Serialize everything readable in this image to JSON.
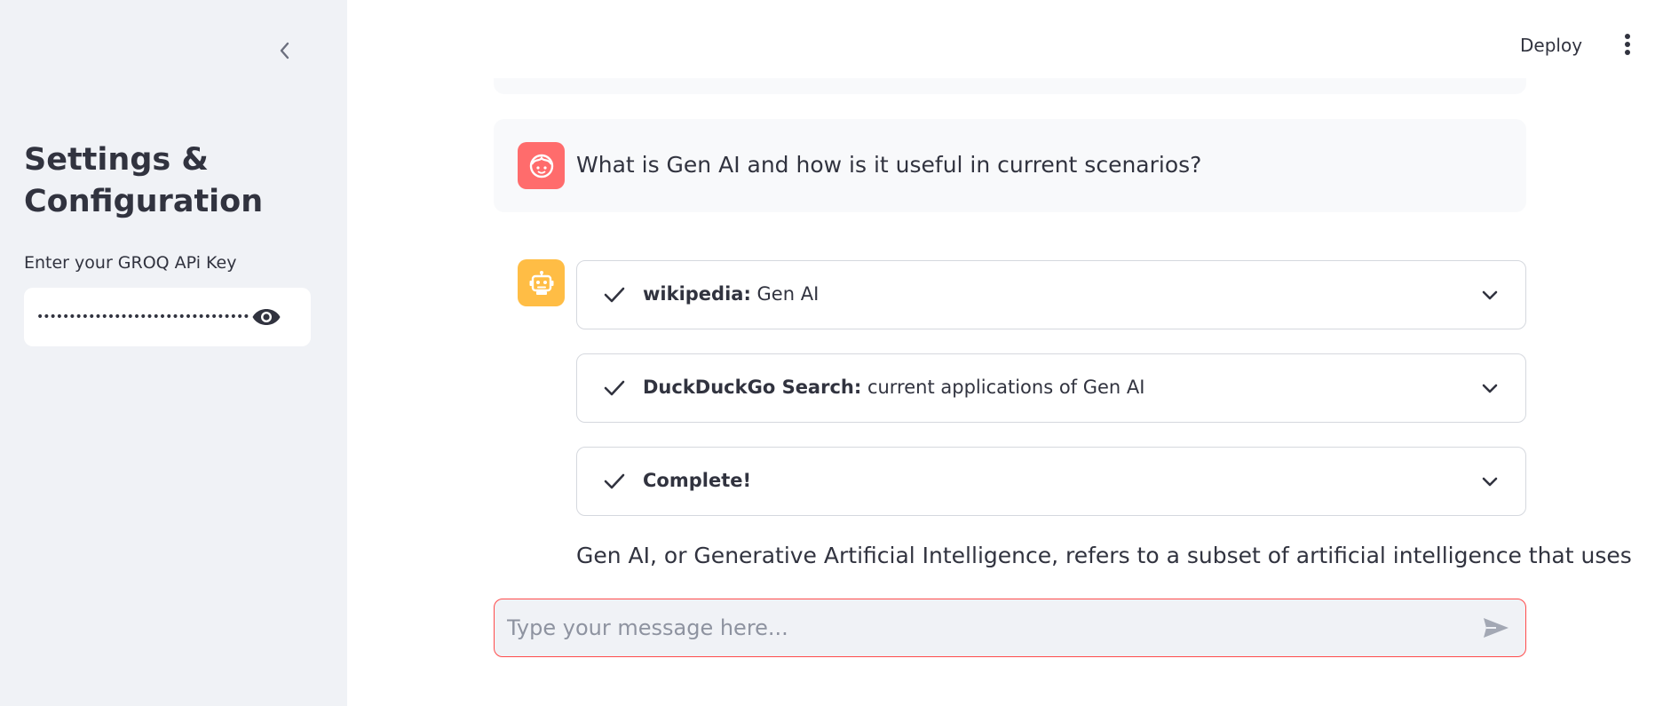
{
  "sidebar": {
    "collapse_icon": "chevron-left-icon",
    "title": "Settings & Configuration",
    "api_key_label": "Enter your GROQ APi Key",
    "api_key_value": "••••••••••••••••••••••••••••••••••",
    "reveal_icon": "eye-icon"
  },
  "header": {
    "deploy_label": "Deploy",
    "menu_icon": "kebab-menu-icon"
  },
  "chat": {
    "user_message": "What is Gen AI and how is it useful in current scenarios?",
    "statuses": [
      {
        "label": "wikipedia:",
        "detail": " Gen AI",
        "state": "complete"
      },
      {
        "label": "DuckDuckGo Search:",
        "detail": " current applications of Gen AI",
        "state": "complete"
      },
      {
        "label": "Complete!",
        "detail": "",
        "state": "complete"
      }
    ],
    "answer_text": "Gen AI, or Generative Artificial Intelligence, refers to a subset of artificial intelligence that uses"
  },
  "chat_input": {
    "placeholder": "Type your message here..."
  },
  "colors": {
    "sidebar_bg": "#f0f2f6",
    "user_avatar": "#ff6c6c",
    "bot_avatar": "#ffbd45",
    "input_focus_border": "#ff4b4b",
    "text": "#31333f"
  }
}
